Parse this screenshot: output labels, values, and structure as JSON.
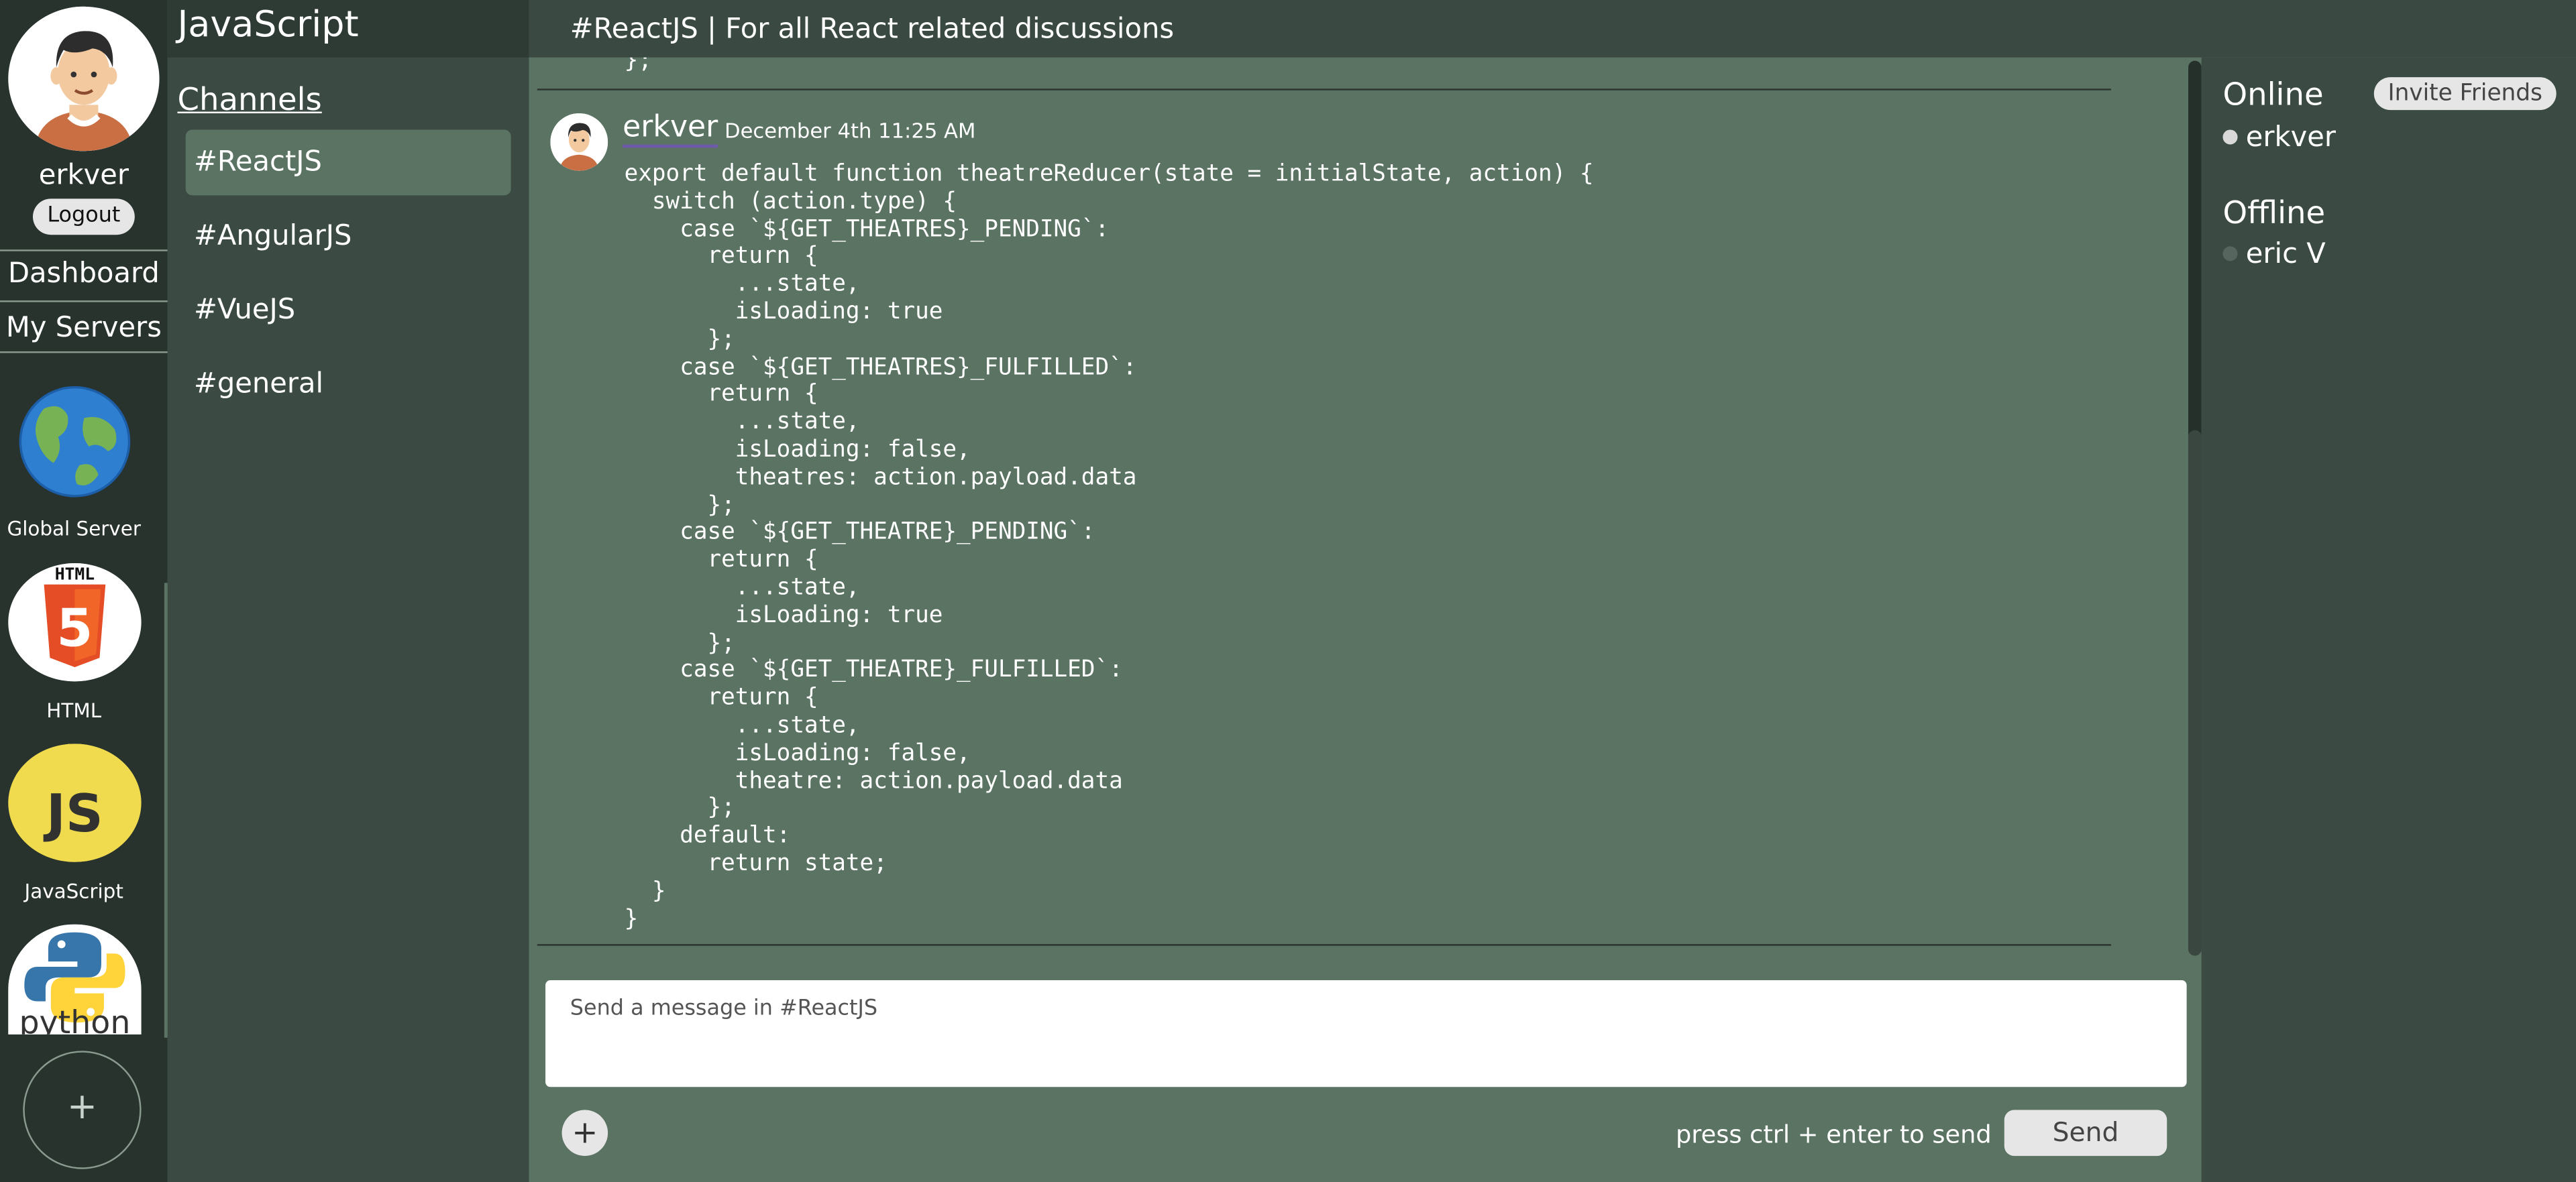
{
  "app": {
    "server_title": "JavaScript",
    "channel_title": "#ReactJS | For all React related discussions"
  },
  "user": {
    "name": "erkver",
    "logout_label": "Logout"
  },
  "rail": {
    "nav": [
      {
        "label": "Dashboard"
      },
      {
        "label": "My Servers"
      }
    ],
    "servers": [
      {
        "label": "Global Server",
        "icon": "globe-icon"
      },
      {
        "label": "HTML",
        "icon": "html5-icon",
        "icon_text": "HTML",
        "badge_text": "5"
      },
      {
        "label": "JavaScript",
        "icon": "javascript-icon",
        "icon_text": "JS"
      },
      {
        "label": "python",
        "icon": "python-icon",
        "icon_text": "python"
      }
    ],
    "add_label": "+"
  },
  "channels": {
    "header": "Channels",
    "items": [
      {
        "label": "#ReactJS",
        "active": true
      },
      {
        "label": "#AngularJS"
      },
      {
        "label": "#VueJS"
      },
      {
        "label": "#general"
      }
    ]
  },
  "messages": {
    "previous_tail": "};",
    "current": {
      "author": "erkver",
      "timestamp": "December 4th 11:25 AM",
      "code": "export default function theatreReducer(state = initialState, action) {\n  switch (action.type) {\n    case `${GET_THEATRES}_PENDING`:\n      return {\n        ...state,\n        isLoading: true\n      };\n    case `${GET_THEATRES}_FULFILLED`:\n      return {\n        ...state,\n        isLoading: false,\n        theatres: action.payload.data\n      };\n    case `${GET_THEATRE}_PENDING`:\n      return {\n        ...state,\n        isLoading: true\n      };\n    case `${GET_THEATRE}_FULFILLED`:\n      return {\n        ...state,\n        isLoading: false,\n        theatre: action.payload.data\n      };\n    default:\n      return state;\n  }\n}"
    }
  },
  "composer": {
    "placeholder": "Send a message in #ReactJS",
    "attach_label": "+",
    "hint": "press ctrl + enter to send",
    "send_label": "Send"
  },
  "members": {
    "online_label": "Online",
    "offline_label": "Offline",
    "invite_label": "Invite Friends",
    "online": [
      "erkver"
    ],
    "offline": [
      "eric V"
    ]
  },
  "colors": {
    "background": "#5b7363",
    "panel": "#3b4b43",
    "rail": "#28332e",
    "header": "#2e3a34",
    "username_underline": "#6d5aa8"
  }
}
